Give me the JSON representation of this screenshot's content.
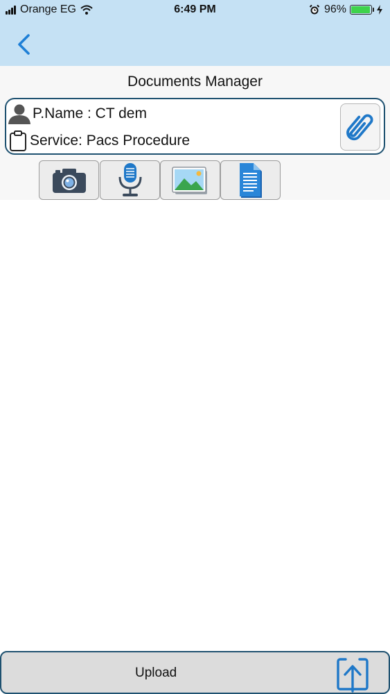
{
  "status_bar": {
    "carrier": "Orange EG",
    "time": "6:49 PM",
    "battery_percent": "96%",
    "battery_level": 0.96,
    "icons": [
      "signal-icon",
      "wifi-icon",
      "alarm-icon",
      "battery-icon",
      "charging-icon"
    ]
  },
  "nav": {
    "back_icon": "chevron-left-icon",
    "accent_color": "#1e7fd6"
  },
  "page": {
    "title": "Documents Manager"
  },
  "info_card": {
    "patient_name": "P.Name : CT dem",
    "service": "Service: Pacs Procedure",
    "icons": [
      "person-icon",
      "clipboard-icon",
      "paperclip-icon"
    ],
    "border_color": "#1e5170"
  },
  "toolbar": {
    "buttons": [
      {
        "name": "camera-button",
        "icon": "camera-icon"
      },
      {
        "name": "microphone-button",
        "icon": "microphone-icon"
      },
      {
        "name": "gallery-button",
        "icon": "image-icon"
      },
      {
        "name": "document-button",
        "icon": "document-icon"
      }
    ]
  },
  "footer": {
    "upload_label": "Upload",
    "upload_icon": "upload-icon"
  }
}
